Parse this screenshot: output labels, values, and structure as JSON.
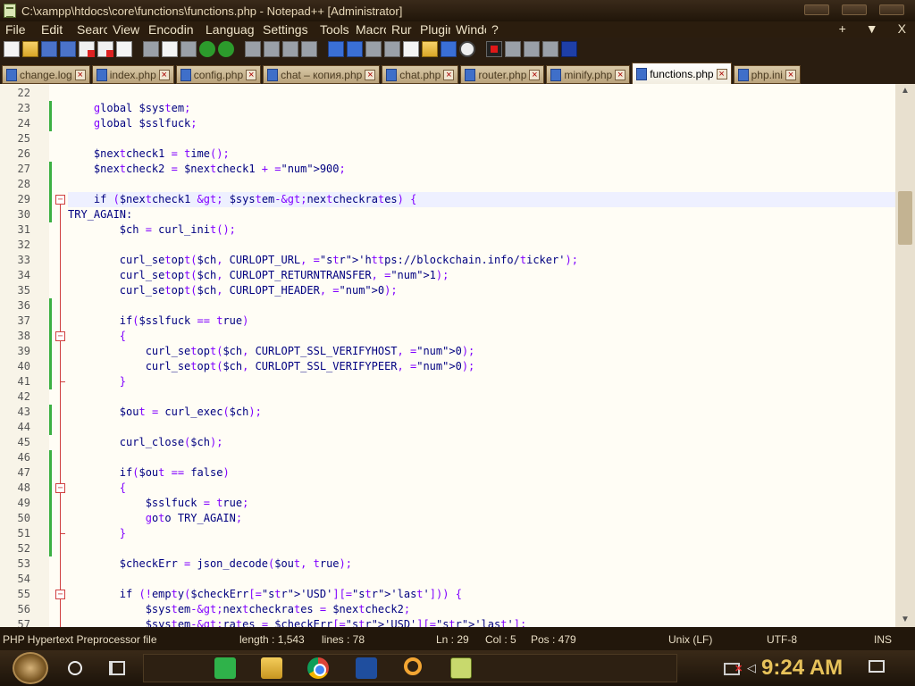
{
  "window": {
    "title": "C:\\xampp\\htdocs\\core\\functions\\functions.php - Notepad++ [Administrator]"
  },
  "menu": {
    "items": [
      "File",
      "Edit",
      "Searcl",
      "View",
      "Encodin",
      "Languag",
      "Settings",
      "Tools",
      "Macro",
      "Rur",
      "Plugin:",
      "Windov",
      "?"
    ],
    "right": [
      "+",
      "▼",
      "X"
    ]
  },
  "tabs": [
    {
      "label": "change.log",
      "active": false
    },
    {
      "label": "index.php",
      "active": false
    },
    {
      "label": "config.php",
      "active": false
    },
    {
      "label": "chat – копия.php",
      "active": false
    },
    {
      "label": "chat.php",
      "active": false
    },
    {
      "label": "router.php",
      "active": false
    },
    {
      "label": "minify.php",
      "active": false
    },
    {
      "label": "functions.php",
      "active": true
    },
    {
      "label": "php.ini",
      "active": false
    }
  ],
  "editor": {
    "current_line": 29,
    "lines": [
      {
        "n": 22,
        "text": "",
        "changed": false,
        "fold": ""
      },
      {
        "n": 23,
        "text": "    global $system;",
        "changed": true,
        "fold": ""
      },
      {
        "n": 24,
        "text": "    global $sslfuck;",
        "changed": true,
        "fold": ""
      },
      {
        "n": 25,
        "text": "",
        "changed": false,
        "fold": ""
      },
      {
        "n": 26,
        "text": "    $nextcheck1 = time();",
        "changed": false,
        "fold": ""
      },
      {
        "n": 27,
        "text": "    $nextcheck2 = $nextcheck1 + 900;",
        "changed": true,
        "fold": ""
      },
      {
        "n": 28,
        "text": "",
        "changed": true,
        "fold": ""
      },
      {
        "n": 29,
        "text": "    if ($nextcheck1 > $system->nextcheckrates) {",
        "changed": true,
        "fold": "open"
      },
      {
        "n": 30,
        "text": "TRY_AGAIN:",
        "changed": true,
        "fold": ""
      },
      {
        "n": 31,
        "text": "        $ch = curl_init();",
        "changed": false,
        "fold": ""
      },
      {
        "n": 32,
        "text": "",
        "changed": false,
        "fold": ""
      },
      {
        "n": 33,
        "text": "        curl_setopt($ch, CURLOPT_URL, 'https://blockchain.info/ticker');",
        "changed": false,
        "fold": ""
      },
      {
        "n": 34,
        "text": "        curl_setopt($ch, CURLOPT_RETURNTRANSFER, 1);",
        "changed": false,
        "fold": ""
      },
      {
        "n": 35,
        "text": "        curl_setopt($ch, CURLOPT_HEADER, 0);",
        "changed": false,
        "fold": ""
      },
      {
        "n": 36,
        "text": "",
        "changed": true,
        "fold": ""
      },
      {
        "n": 37,
        "text": "        if($sslfuck == true)",
        "changed": true,
        "fold": ""
      },
      {
        "n": 38,
        "text": "        {",
        "changed": true,
        "fold": "open"
      },
      {
        "n": 39,
        "text": "            curl_setopt($ch, CURLOPT_SSL_VERIFYHOST, 0);",
        "changed": true,
        "fold": ""
      },
      {
        "n": 40,
        "text": "            curl_setopt($ch, CURLOPT_SSL_VERIFYPEER, 0);",
        "changed": true,
        "fold": ""
      },
      {
        "n": 41,
        "text": "        }",
        "changed": true,
        "fold": "end"
      },
      {
        "n": 42,
        "text": "",
        "changed": false,
        "fold": ""
      },
      {
        "n": 43,
        "text": "        $out = curl_exec($ch);",
        "changed": true,
        "fold": ""
      },
      {
        "n": 44,
        "text": "",
        "changed": true,
        "fold": ""
      },
      {
        "n": 45,
        "text": "        curl_close($ch);",
        "changed": false,
        "fold": ""
      },
      {
        "n": 46,
        "text": "",
        "changed": true,
        "fold": ""
      },
      {
        "n": 47,
        "text": "        if($out == false)",
        "changed": true,
        "fold": ""
      },
      {
        "n": 48,
        "text": "        {",
        "changed": true,
        "fold": "open"
      },
      {
        "n": 49,
        "text": "            $sslfuck = true;",
        "changed": true,
        "fold": ""
      },
      {
        "n": 50,
        "text": "            goto TRY_AGAIN;",
        "changed": true,
        "fold": ""
      },
      {
        "n": 51,
        "text": "        }",
        "changed": true,
        "fold": "end"
      },
      {
        "n": 52,
        "text": "",
        "changed": true,
        "fold": ""
      },
      {
        "n": 53,
        "text": "        $checkErr = json_decode($out, true);",
        "changed": false,
        "fold": ""
      },
      {
        "n": 54,
        "text": "",
        "changed": false,
        "fold": ""
      },
      {
        "n": 55,
        "text": "        if (!empty($checkErr['USD']['last'])) {",
        "changed": false,
        "fold": "open"
      },
      {
        "n": 56,
        "text": "            $system->nextcheckrates = $nextcheck2;",
        "changed": false,
        "fold": ""
      },
      {
        "n": 57,
        "text": "            $system->rates = $checkErr['USD']['last'];",
        "changed": false,
        "fold": ""
      }
    ]
  },
  "status": {
    "language": "PHP Hypertext Preprocessor file",
    "length": "length : 1,543",
    "lines": "lines : 78",
    "ln": "Ln : 29",
    "col": "Col : 5",
    "pos": "Pos : 479",
    "eol": "Unix (LF)",
    "encoding": "UTF-8",
    "mode": "INS"
  },
  "taskbar": {
    "clock": "9:24 AM"
  },
  "colors": {
    "accent": "#e7c25a",
    "change_marker": "#3cb043",
    "fold_marker": "#d04040"
  }
}
